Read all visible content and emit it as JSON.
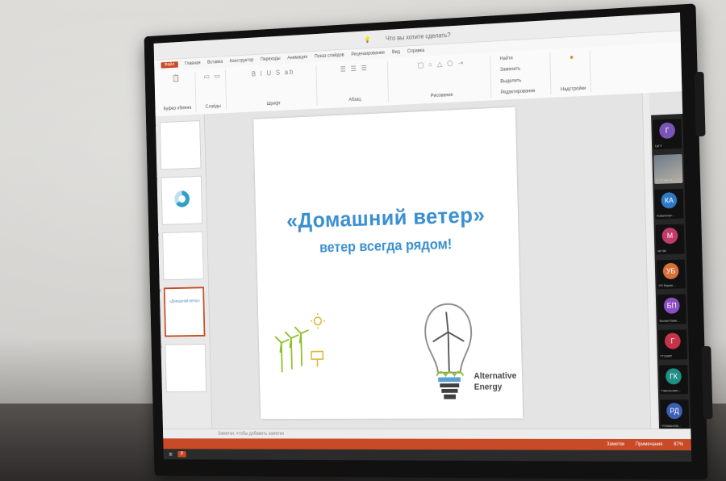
{
  "ppt": {
    "title_bar": "Что вы хотите сделать?",
    "file_tab": "Файл",
    "tabs": [
      "Главная",
      "Вставка",
      "Конструктор",
      "Переходы",
      "Анимация",
      "Показ слайдов",
      "Рецензирование",
      "Вид",
      "Справка"
    ],
    "ribbon_groups": [
      "Буфер обмена",
      "Слайды",
      "Шрифт",
      "Абзац",
      "Рисование",
      "Редактирование",
      "Надстройки"
    ],
    "ribbon_right": {
      "find": "Найти",
      "replace": "Заменить",
      "select": "Выделить",
      "addins": "Надстройки"
    },
    "notes_placeholder": "Заметки, чтобы добавить заметки",
    "status": {
      "notes": "Заметки",
      "comments": "Примечания",
      "zoom": "87%"
    }
  },
  "slide": {
    "title": "«Домашний ветер»",
    "subtitle": "ветер всегда рядом!",
    "logo_line1": "Alternative",
    "logo_line2": "Energy"
  },
  "thumbnails": [
    {
      "num": "1",
      "active": false
    },
    {
      "num": "2",
      "active": false
    },
    {
      "num": "3",
      "active": false
    },
    {
      "num": "4",
      "active": true
    },
    {
      "num": "5",
      "active": false
    }
  ],
  "participants": [
    {
      "initials": "Г",
      "name": "ГрГУ",
      "color": "#7a55b8"
    },
    {
      "initials": "",
      "name": "ГГТУ им. П...",
      "color": "#000000",
      "video": true
    },
    {
      "initials": "КА",
      "name": "Ковальчук...",
      "color": "#2f79c4"
    },
    {
      "initials": "М",
      "name": "МГЭК",
      "color": "#c23a6b"
    },
    {
      "initials": "УБ",
      "name": "УО Баран...",
      "color": "#d8703a"
    },
    {
      "initials": "БП",
      "name": "Белая Пави...",
      "color": "#8a4fc0"
    },
    {
      "initials": "Г",
      "name": "ГГЭЭКТ",
      "color": "#c7344a"
    },
    {
      "initials": "ГК",
      "name": "Гавельские...",
      "color": "#1f8f86"
    },
    {
      "initials": "РД",
      "name": "РОМАНОВ...",
      "color": "#3c5fb5"
    }
  ],
  "colors": {
    "accent": "#c84a26",
    "slide_text": "#3a8fd0",
    "turbine_green": "#8fbf2a"
  }
}
